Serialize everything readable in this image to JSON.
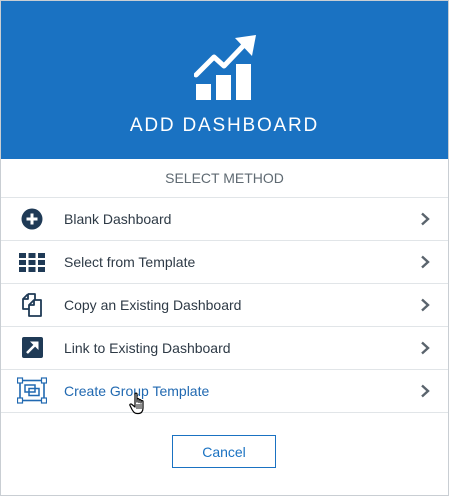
{
  "header": {
    "title": "ADD DASHBOARD",
    "icon": "chart-growth-icon",
    "background_color": "#1a72c2"
  },
  "subheader": {
    "label": "SELECT METHOD"
  },
  "methods": [
    {
      "label": "Blank Dashboard",
      "icon": "plus-circle-icon"
    },
    {
      "label": "Select from Template",
      "icon": "grid-icon"
    },
    {
      "label": "Copy an Existing Dashboard",
      "icon": "copy-icon"
    },
    {
      "label": "Link to Existing Dashboard",
      "icon": "link-arrow-icon"
    },
    {
      "label": "Create Group Template",
      "icon": "group-template-icon",
      "state": "hovered"
    }
  ],
  "footer": {
    "cancel_label": "Cancel"
  },
  "colors": {
    "accent": "#1a72c2",
    "text": "#2e3a46",
    "icon": "#1f3a56"
  }
}
